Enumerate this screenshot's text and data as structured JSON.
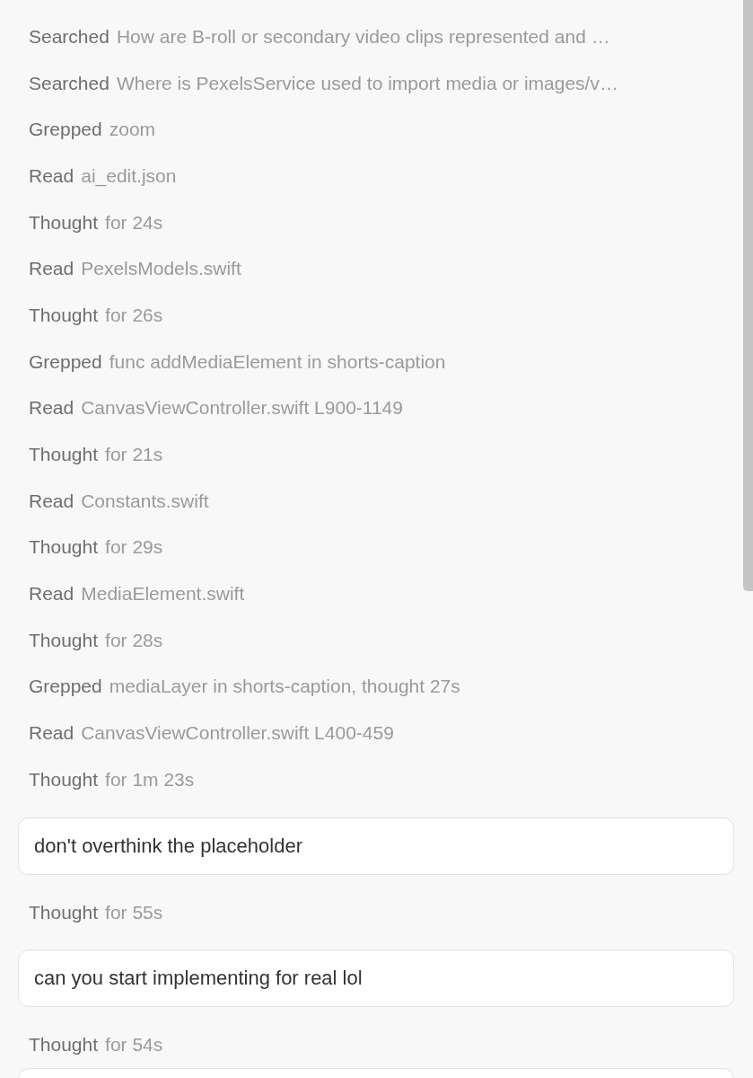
{
  "items": [
    {
      "kind": "step",
      "verb": "Searched",
      "detail": "How are B-roll or secondary video clips represented and …"
    },
    {
      "kind": "step",
      "verb": "Searched",
      "detail": "Where is PexelsService used to import media or images/v…"
    },
    {
      "kind": "step",
      "verb": "Grepped",
      "detail": "zoom"
    },
    {
      "kind": "step",
      "verb": "Read",
      "detail": "ai_edit.json"
    },
    {
      "kind": "step",
      "verb": "Thought",
      "detail": "for 24s"
    },
    {
      "kind": "step",
      "verb": "Read",
      "detail": "PexelsModels.swift"
    },
    {
      "kind": "step",
      "verb": "Thought",
      "detail": "for 26s"
    },
    {
      "kind": "step",
      "verb": "Grepped",
      "detail": "func addMediaElement in shorts-caption"
    },
    {
      "kind": "step",
      "verb": "Read",
      "detail": "CanvasViewController.swift L900-1149"
    },
    {
      "kind": "step",
      "verb": "Thought",
      "detail": "for 21s"
    },
    {
      "kind": "step",
      "verb": "Read",
      "detail": "Constants.swift"
    },
    {
      "kind": "step",
      "verb": "Thought",
      "detail": "for 29s"
    },
    {
      "kind": "step",
      "verb": "Read",
      "detail": "MediaElement.swift"
    },
    {
      "kind": "step",
      "verb": "Thought",
      "detail": "for 28s"
    },
    {
      "kind": "step",
      "verb": "Grepped",
      "detail": "mediaLayer in shorts-caption, thought 27s"
    },
    {
      "kind": "step",
      "verb": "Read",
      "detail": "CanvasViewController.swift L400-459"
    },
    {
      "kind": "step",
      "verb": "Thought",
      "detail": "for 1m 23s"
    },
    {
      "kind": "message",
      "text": "don't overthink the placeholder"
    },
    {
      "kind": "step",
      "verb": "Thought",
      "detail": "for 55s"
    },
    {
      "kind": "message",
      "text": "can you start implementing for real lol"
    },
    {
      "kind": "step",
      "verb": "Thought",
      "detail": "for 54s"
    },
    {
      "kind": "message"
    }
  ]
}
